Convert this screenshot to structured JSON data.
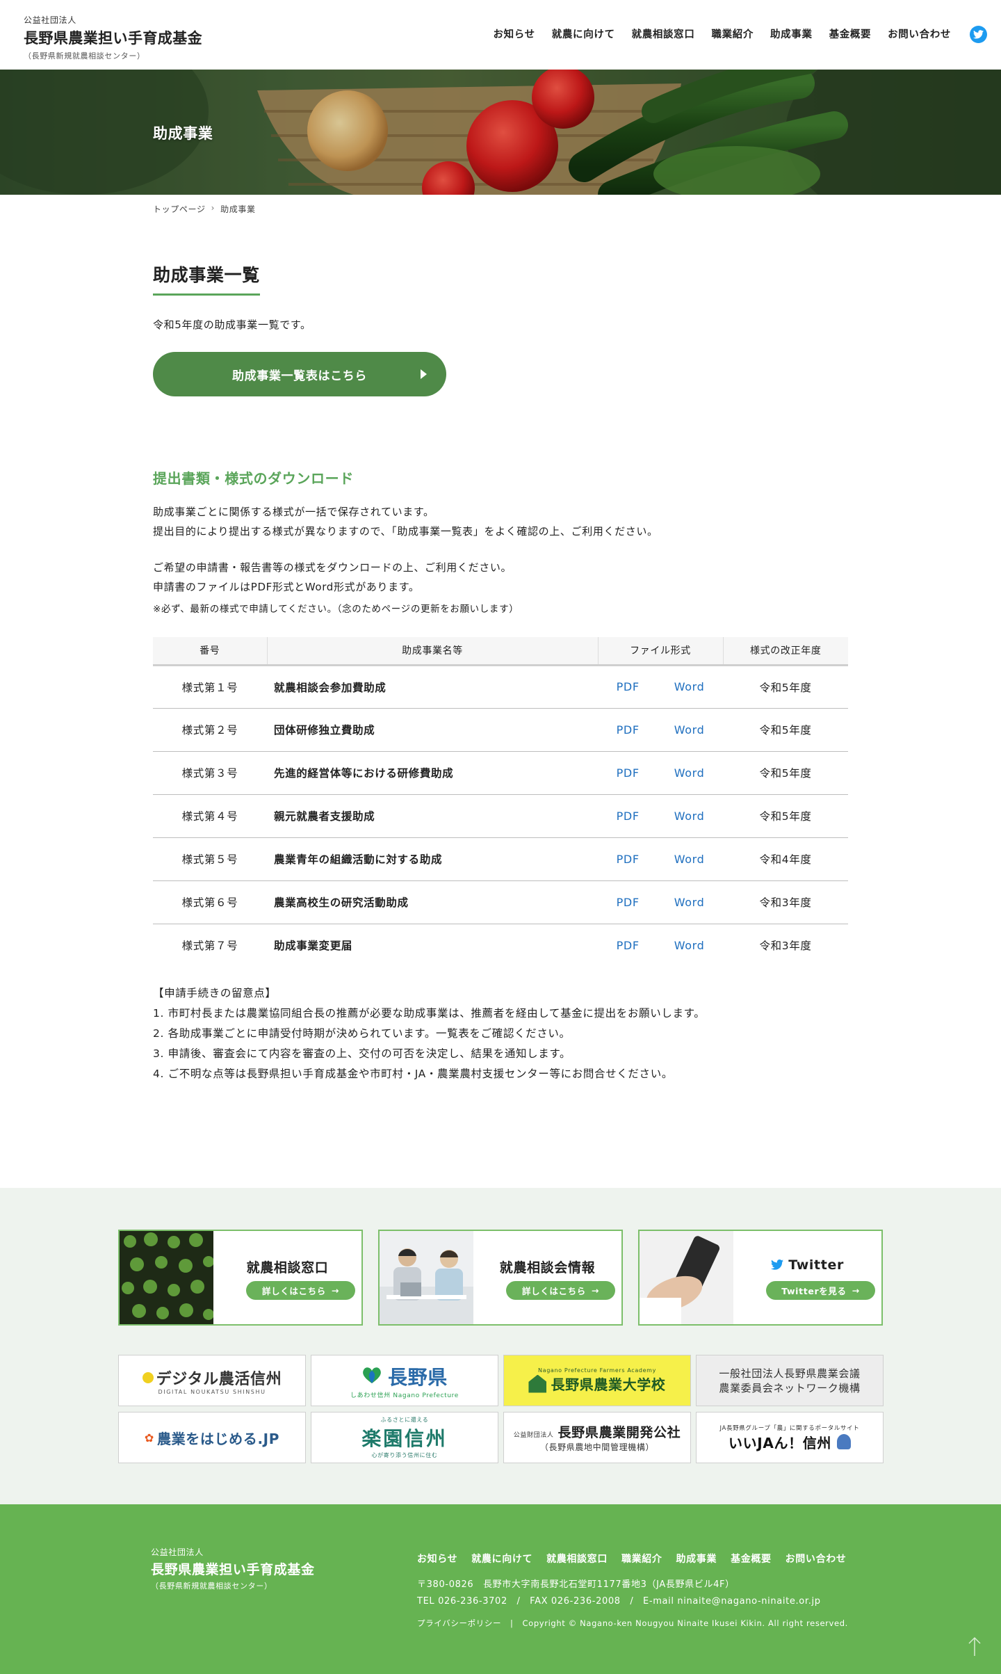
{
  "header": {
    "org_type": "公益社団法人",
    "org_name": "長野県農業担い手育成基金",
    "org_sub": "（長野県新規就農相談センター）",
    "nav": [
      "お知らせ",
      "就農に向けて",
      "就農相談窓口",
      "職業紹介",
      "助成事業",
      "基金概要",
      "お問い合わせ"
    ],
    "twitter_color": "#1d9bf0"
  },
  "hero": {
    "title": "助成事業"
  },
  "breadcrumb": {
    "home": "トップページ",
    "sep": "›",
    "current": "助成事業"
  },
  "main": {
    "heading": "助成事業一覧",
    "intro": "令和5年度の助成事業一覧です。",
    "list_button": "助成事業一覧表はこちら",
    "download_heading": "提出書類・様式のダウンロード",
    "para1_line1": "助成事業ごとに関係する様式が一括で保存されています。",
    "para1_line2": "提出目的により提出する様式が異なりますので、「助成事業一覧表」をよく確認の上、ご利用ください。",
    "para2_line1": "ご希望の申請書・報告書等の様式をダウンロードの上、ご利用ください。",
    "para2_line2": "申請書のファイルはPDF形式とWord形式があります。",
    "note": "※必ず、最新の様式で申請してください。（念のためページの更新をお願いします）",
    "accent_color": "#5aa55a"
  },
  "table": {
    "headers": [
      "番号",
      "助成事業名等",
      "ファイル形式",
      "様式の改正年度"
    ],
    "rows": [
      {
        "num": "様式第１号",
        "title": "就農相談会参加費助成",
        "pdf": "PDF",
        "word": "Word",
        "year": "令和5年度"
      },
      {
        "num": "様式第２号",
        "title": "団体研修独立費助成",
        "pdf": "PDF",
        "word": "Word",
        "year": "令和5年度"
      },
      {
        "num": "様式第３号",
        "title": "先進的経営体等における研修費助成",
        "pdf": "PDF",
        "word": "Word",
        "year": "令和5年度"
      },
      {
        "num": "様式第４号",
        "title": "親元就農者支援助成",
        "pdf": "PDF",
        "word": "Word",
        "year": "令和5年度"
      },
      {
        "num": "様式第５号",
        "title": "農業青年の組織活動に対する助成",
        "pdf": "PDF",
        "word": "Word",
        "year": "令和4年度"
      },
      {
        "num": "様式第６号",
        "title": "農業高校生の研究活動助成",
        "pdf": "PDF",
        "word": "Word",
        "year": "令和3年度"
      },
      {
        "num": "様式第７号",
        "title": "助成事業変更届",
        "pdf": "PDF",
        "word": "Word",
        "year": "令和3年度"
      }
    ]
  },
  "notes": {
    "title": "【申請手続きの留意点】",
    "items": [
      "1. 市町村長または農業協同組合長の推薦が必要な助成事業は、推薦者を経由して基金に提出をお願いします。",
      "2. 各助成事業ごとに申請受付時期が決められています。一覧表をご確認ください。",
      "3. 申請後、審査会にて内容を審査の上、交付の可否を決定し、結果を通知します。",
      "4. ご不明な点等は長野県担い手育成基金や市町村・JA・農業農村支援センター等にお問合せください。"
    ]
  },
  "cards": [
    {
      "title": "就農相談窓口",
      "button": "詳しくはこちら"
    },
    {
      "title": "就農相談会情報",
      "button": "詳しくはこちら"
    },
    {
      "title": "Twitter",
      "button": "Twitterを見る"
    }
  ],
  "banners": {
    "b1_main": "デジタル農活信州",
    "b1_sub": "DIGITAL NOUKATSU SHINSHU",
    "b2_main": "長野県",
    "b2_sub": "しあわせ信州 Nagano Prefecture",
    "b3_top": "Nagano Prefecture Farmers Academy",
    "b3_main": "長野県農業大学校",
    "b4_line1": "一般社団法人長野県農業会議",
    "b4_line2": "農業委員会ネットワーク機構",
    "b5_main": "農業をはじめる.JP",
    "b6_top": "ふるさとに還える",
    "b6_main": "楽園信州",
    "b6_sub": "心が寄り添う信州に住む",
    "b7_org": "公益財団法人",
    "b7_main": "長野県農業開発公社",
    "b7_sub": "（長野県農地中間管理機構）",
    "b8_top": "JA長野県グループ「農」に関するポータルサイト",
    "b8_main": "いいJAん！信州"
  },
  "footer": {
    "org_type": "公益社団法人",
    "org_name": "長野県農業担い手育成基金",
    "org_sub": "（長野県新規就農相談センター）",
    "nav": [
      "お知らせ",
      "就農に向けて",
      "就農相談窓口",
      "職業紹介",
      "助成事業",
      "基金概要",
      "お問い合わせ"
    ],
    "address": "〒380-0826　長野市大字南長野北石堂町1177番地3（JA長野県ビル4F）",
    "contact": "TEL 026-236-3702　/　FAX 026-236-2008　/　E-mail ninaite@nagano-ninaite.or.jp",
    "privacy": "プライバシーポリシー",
    "copyright": "Copyright © Nagano-ken Nougyou Ninaite Ikusei Kikin. All right reserved.",
    "bg_color": "#66b352"
  }
}
